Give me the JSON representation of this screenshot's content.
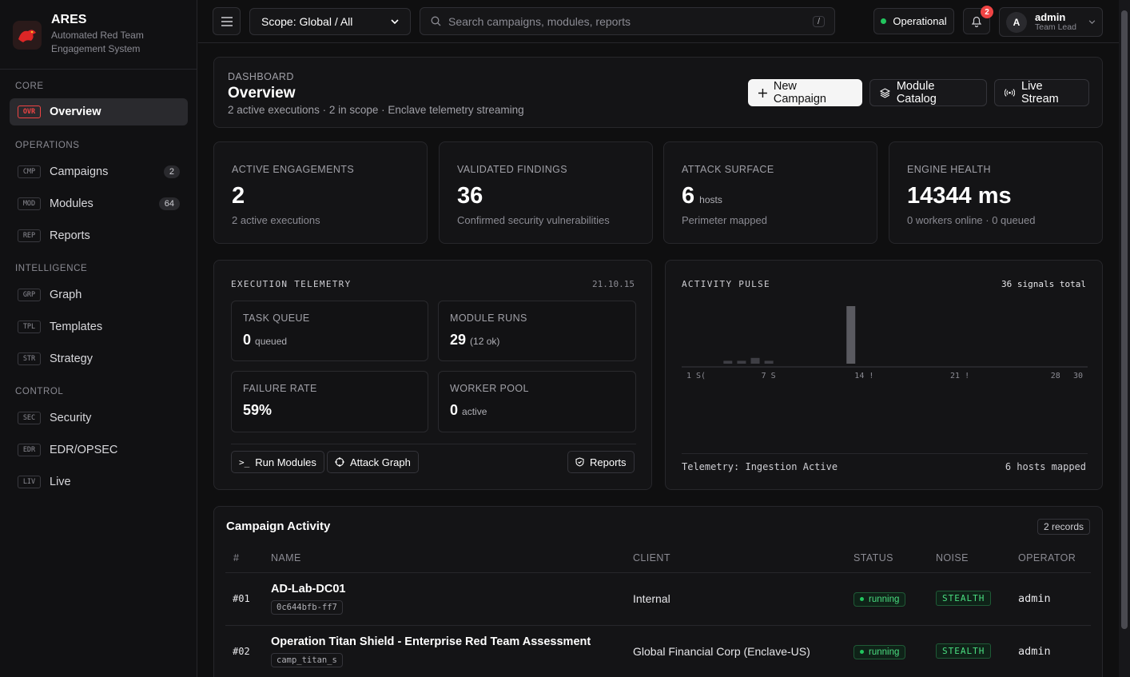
{
  "brand": {
    "title": "ARES",
    "subtitle_line1": "Automated Red Team",
    "subtitle_line2": "Engagement System"
  },
  "sidebar": {
    "sections": [
      "CORE",
      "OPERATIONS",
      "INTELLIGENCE",
      "CONTROL"
    ],
    "items": [
      {
        "code": "OVR",
        "label": "Overview"
      },
      {
        "code": "CMP",
        "label": "Campaigns",
        "count": "2"
      },
      {
        "code": "MOD",
        "label": "Modules",
        "count": "64"
      },
      {
        "code": "REP",
        "label": "Reports"
      },
      {
        "code": "GRP",
        "label": "Graph"
      },
      {
        "code": "TPL",
        "label": "Templates"
      },
      {
        "code": "STR",
        "label": "Strategy"
      },
      {
        "code": "SEC",
        "label": "Security"
      },
      {
        "code": "EDR",
        "label": "EDR/OPSEC"
      },
      {
        "code": "LIV",
        "label": "Live"
      }
    ]
  },
  "topbar": {
    "scope": "Scope: Global / All",
    "search_placeholder": "Search campaigns, modules, reports",
    "search_kbd": "/",
    "status": "Operational",
    "notif_count": "2",
    "user_initial": "A",
    "user_name": "admin",
    "user_role": "Team Lead"
  },
  "header": {
    "eyebrow": "DASHBOARD",
    "title": "Overview",
    "subtitle": "2 active executions · 2 in scope · Enclave telemetry streaming",
    "buttons": {
      "new_campaign": "New Campaign",
      "module_catalog": "Module Catalog",
      "live_stream": "Live Stream"
    }
  },
  "stats": [
    {
      "label": "ACTIVE ENGAGEMENTS",
      "value": "2",
      "unit": "",
      "sub": "2 active executions"
    },
    {
      "label": "VALIDATED FINDINGS",
      "value": "36",
      "unit": "",
      "sub": "Confirmed security vulnerabilities"
    },
    {
      "label": "ATTACK SURFACE",
      "value": "6",
      "unit": "hosts",
      "sub": "Perimeter mapped"
    },
    {
      "label": "ENGINE HEALTH",
      "value": "14344 ms",
      "unit": "",
      "sub": "0 workers online · 0 queued"
    }
  ],
  "telemetry": {
    "title": "EXECUTION TELEMETRY",
    "time": "21.10.15",
    "boxes": [
      {
        "label": "TASK QUEUE",
        "value": "0",
        "unit": "queued"
      },
      {
        "label": "MODULE RUNS",
        "value": "29",
        "unit": "(12 ok)"
      },
      {
        "label": "FAILURE RATE",
        "value": "59%",
        "unit": ""
      },
      {
        "label": "WORKER POOL",
        "value": "0",
        "unit": "active"
      }
    ],
    "buttons": {
      "run_modules": "Run Modules",
      "attack_graph": "Attack Graph",
      "reports": "Reports"
    }
  },
  "pulse": {
    "title": "ACTIVITY PULSE",
    "total": "36 signals total",
    "footer_left": "Telemetry: Ingestion Active",
    "footer_right": "6 hosts mapped",
    "ticks": [
      "1 S(",
      "7 S",
      "14 !",
      "21 !",
      "28",
      "30"
    ]
  },
  "chart_data": {
    "type": "bar",
    "x": [
      4,
      5,
      6,
      7,
      8,
      13
    ],
    "values": [
      1,
      1,
      2,
      1,
      0,
      20
    ],
    "xlim": [
      1,
      30
    ],
    "ylim": [
      0,
      20
    ]
  },
  "campaigns": {
    "title": "Campaign Activity",
    "records": "2 records",
    "columns": [
      "#",
      "NAME",
      "CLIENT",
      "STATUS",
      "NOISE",
      "OPERATOR"
    ],
    "rows": [
      {
        "num": "#01",
        "name": "AD-Lab-DC01",
        "id": "0c644bfb-ff7",
        "client": "Internal",
        "status": "running",
        "noise": "STEALTH",
        "operator": "admin"
      },
      {
        "num": "#02",
        "name": "Operation Titan Shield - Enterprise Red Team Assessment",
        "id": "camp_titan_s",
        "client": "Global Financial Corp (Enclave-US)",
        "status": "running",
        "noise": "STEALTH",
        "operator": "admin"
      }
    ]
  }
}
